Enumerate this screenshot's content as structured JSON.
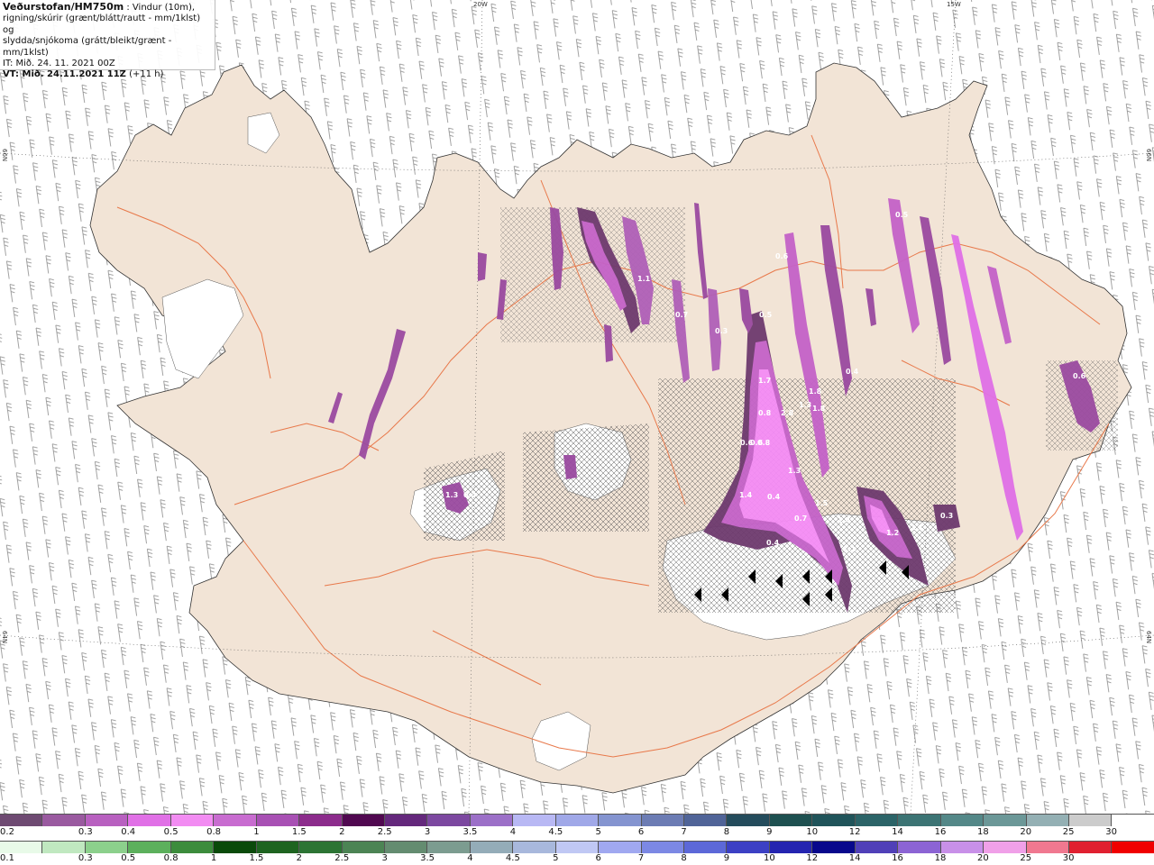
{
  "header": {
    "title": "Veðurstofan/HM750m",
    "desc1": ": Vindur (10m),",
    "desc2": "rigning/skúrir (grænt/blátt/rautt - mm/1klst) og",
    "desc3": "slydda/snjókoma (grátt/bleikt/grænt - mm/1klst)",
    "it": "IT: Mið. 24. 11. 2021 00Z",
    "vt": "VT: Mið. 24.11.2021 11Z",
    "vt_offset": "(+11 h)"
  },
  "graticule_labels": {
    "top_20w": "20W",
    "top_15w": "15W",
    "left_66n": "66N",
    "left_64n": "64N",
    "right_66n": "66N",
    "right_64n": "64N"
  },
  "colors": {
    "land": "#f2e4d6",
    "road": "#e8784a",
    "glacier": "#ffffff",
    "snow_light": "#f58cf5",
    "snow_mid": "#c462c8",
    "snow_dark": "#6e3a6e"
  },
  "precip_labels": [
    {
      "text": "1.3"
    },
    {
      "text": "0.4"
    },
    {
      "text": "1.7"
    },
    {
      "text": "0.8"
    },
    {
      "text": "2.8"
    },
    {
      "text": "1.3"
    },
    {
      "text": "1.8"
    },
    {
      "text": "1.8"
    },
    {
      "text": "0.6"
    },
    {
      "text": "0.6"
    },
    {
      "text": "0.8"
    },
    {
      "text": "1.3"
    },
    {
      "text": "1.4"
    },
    {
      "text": "0.4"
    },
    {
      "text": "0.7"
    },
    {
      "text": "1.5"
    },
    {
      "text": "1.4"
    },
    {
      "text": "0.4"
    },
    {
      "text": "1.1"
    },
    {
      "text": "1.2"
    },
    {
      "text": "1.1"
    },
    {
      "text": "0.3"
    },
    {
      "text": "0.5"
    },
    {
      "text": "0.6"
    },
    {
      "text": "0.5"
    },
    {
      "text": "0.3"
    },
    {
      "text": "0.7"
    },
    {
      "text": "0.4"
    },
    {
      "text": "1.1"
    },
    {
      "text": "0.6"
    }
  ],
  "colorbar_snow": {
    "labels": [
      "0.2",
      "0.3",
      "0.4",
      "0.5",
      "0.8",
      "1",
      "1.5",
      "2",
      "2.5",
      "3",
      "3.5",
      "4",
      "4.5",
      "5",
      "6",
      "7",
      "8",
      "9",
      "10",
      "12",
      "14",
      "16",
      "18",
      "20",
      "25",
      "30"
    ],
    "colors": [
      "#6e4a72",
      "#9a5aa0",
      "#b860c0",
      "#e070e6",
      "#f28cf2",
      "#c86cd0",
      "#a850b4",
      "#8c2c8c",
      "#500850",
      "#64287c",
      "#7c48a0",
      "#9c70c8",
      "#b8b8f4",
      "#a0a8e8",
      "#8494d0",
      "#6c7cb4",
      "#506498",
      "#244c5c",
      "#1e5050",
      "#20545a",
      "#2c6468",
      "#3c7474",
      "#548888",
      "#6c9898",
      "#94b0b4",
      "#cccccc",
      "#ffffff"
    ]
  },
  "colorbar_rain": {
    "labels": [
      "0.1",
      "0.3",
      "0.5",
      "0.8",
      "1",
      "1.5",
      "2",
      "2.5",
      "3",
      "3.5",
      "4",
      "4.5",
      "5",
      "6",
      "7",
      "8",
      "9",
      "10",
      "12",
      "14",
      "16",
      "18",
      "20",
      "25",
      "30"
    ],
    "colors": [
      "#e8fae8",
      "#c0e8c0",
      "#8cd08c",
      "#5cb05c",
      "#3c8c3c",
      "#0a4a0a",
      "#1e6420",
      "#2c7434",
      "#4c8454",
      "#648c70",
      "#7c9c90",
      "#94acb8",
      "#a8b8dc",
      "#c0c8f4",
      "#a0a8f0",
      "#7c88e4",
      "#5c68d8",
      "#3c40c4",
      "#2424b0",
      "#08088c",
      "#5040b8",
      "#8c64d4",
      "#c890e8",
      "#f0a0e8",
      "#f07890",
      "#e02030",
      "#f00000"
    ]
  }
}
